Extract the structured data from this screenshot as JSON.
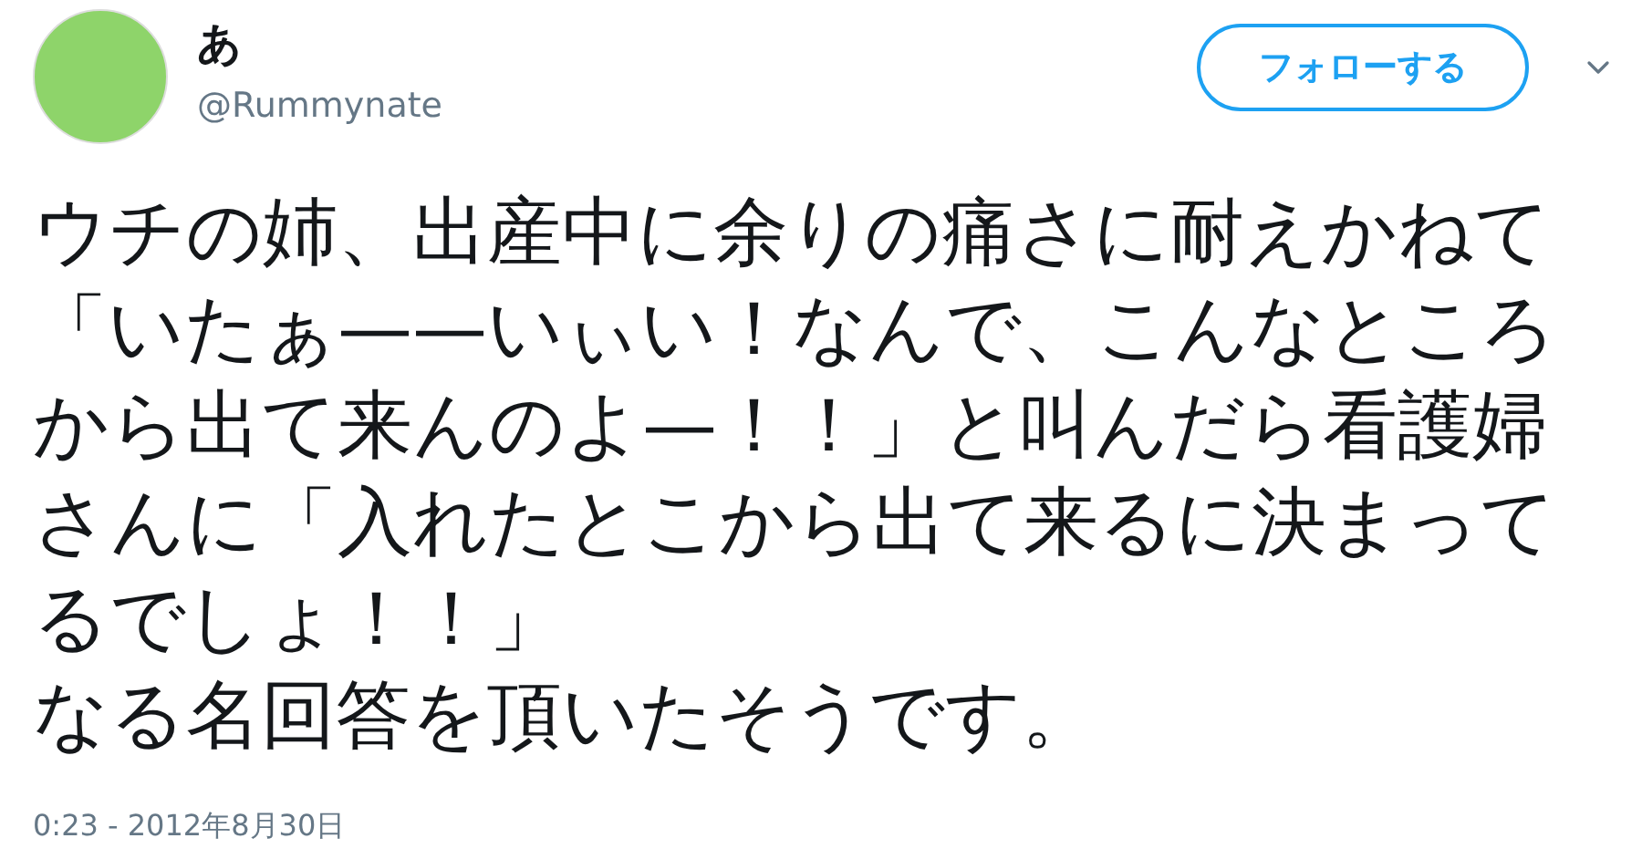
{
  "author": {
    "name": "あ",
    "handle": "@Rummynate"
  },
  "follow_button": {
    "label": "フォローする"
  },
  "tweet": {
    "text_lines": [
      "ウチの姉、出産中に余りの痛さに耐えかねて",
      "「いたぁ——いぃい！なんで、こんなところ",
      "から出て来んのよ—！！」と叫んだら看護婦",
      "さんに「入れたとこから出て来るに決まって",
      "るでしょ！！」",
      "なる名回答を頂いたそうです。"
    ]
  },
  "timestamp": "0:23 - 2012年8月30日"
}
